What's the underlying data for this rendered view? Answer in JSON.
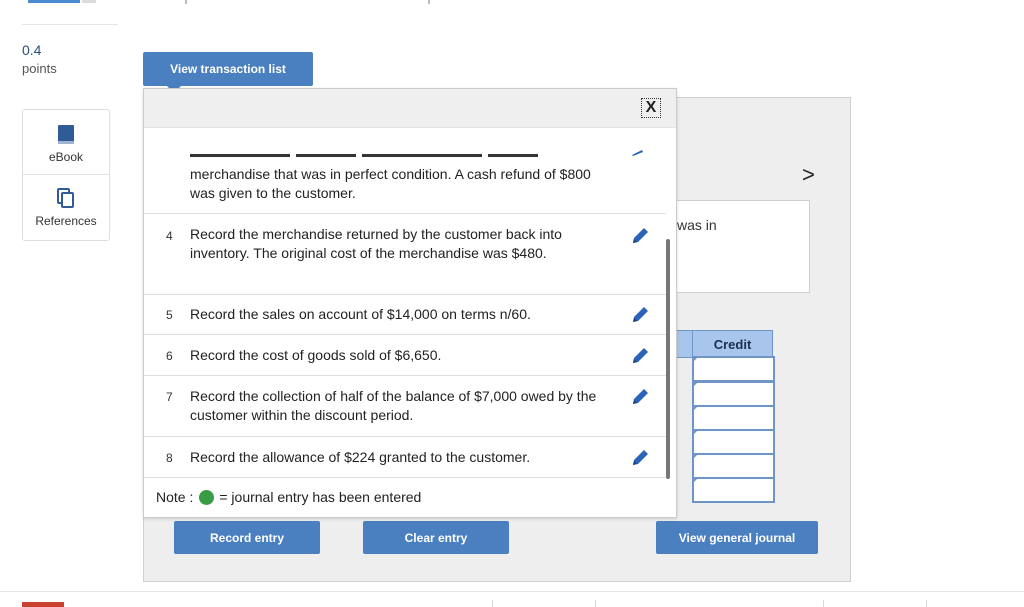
{
  "question": {
    "points_value": "0.4",
    "points_label": "points"
  },
  "sidebar": {
    "items": [
      {
        "label": "eBook",
        "icon": "book-icon"
      },
      {
        "label": "References",
        "icon": "copy-icon"
      }
    ]
  },
  "view_transaction_list_label": "View transaction list",
  "popup": {
    "close_label": "X",
    "partial_row_text": "merchandise that was in perfect condition. A cash refund of $800 was given to the customer.",
    "transactions": [
      {
        "num": "4",
        "text": "Record the merchandise returned by the customer back into inventory. The original cost of the merchandise was $480."
      },
      {
        "num": "5",
        "text": "Record the sales on account of $14,000 on terms n/60."
      },
      {
        "num": "6",
        "text": "Record the cost of goods sold of $6,650."
      },
      {
        "num": "7",
        "text": "Record the collection of half of the balance of $7,000 owed by the customer within the discount period."
      },
      {
        "num": "8",
        "text": "Record the allowance of $224 granted to the customer."
      }
    ],
    "note_prefix": "Note :",
    "note_suffix": "= journal entry has been entered"
  },
  "behind": {
    "partial_text": "was in",
    "chevron": ">",
    "credit_header": "Credit"
  },
  "buttons": {
    "record_entry": "Record entry",
    "clear_entry": "Clear entry",
    "view_general_journal": "View general journal"
  },
  "colors": {
    "accent": "#4a7fc0",
    "entered_dot": "#3a9b45",
    "credit_header": "#a8c6ec"
  }
}
